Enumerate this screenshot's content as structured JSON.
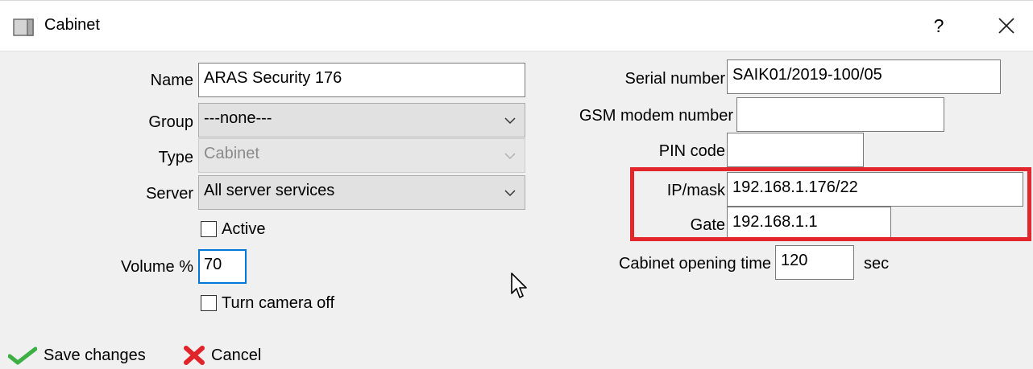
{
  "window": {
    "title": "Cabinet",
    "help_label": "?"
  },
  "form": {
    "name_label": "Name",
    "name_value": "ARAS Security 176",
    "group_label": "Group",
    "group_value": "---none---",
    "type_label": "Type",
    "type_value": "Cabinet",
    "server_label": "Server",
    "server_value": "All server services",
    "active_label": "Active",
    "active_checked": false,
    "volume_label": "Volume %",
    "volume_value": "70",
    "camera_label": "Turn camera off",
    "camera_checked": false,
    "serial_label": "Serial number",
    "serial_value": "SAIK01/2019-100/05",
    "gsm_label": "GSM modem number",
    "gsm_value": "",
    "pin_label": "PIN code",
    "pin_value": "",
    "ip_label": "IP/mask",
    "ip_value": "192.168.1.176/22",
    "gate_label": "Gate",
    "gate_value": "192.168.1.1",
    "opening_label": "Cabinet opening time",
    "opening_value": "120",
    "opening_unit": "sec"
  },
  "actions": {
    "save_label": "Save changes",
    "cancel_label": "Cancel"
  },
  "colors": {
    "highlight": "#e3262b",
    "focus": "#0078d7",
    "save_icon": "#3cb043",
    "cancel_icon": "#e0242a"
  },
  "icons": {
    "app": "window-icon",
    "close": "close-icon",
    "save": "checkmark-icon",
    "cancel": "x-icon",
    "cursor": "mouse-cursor-icon"
  }
}
